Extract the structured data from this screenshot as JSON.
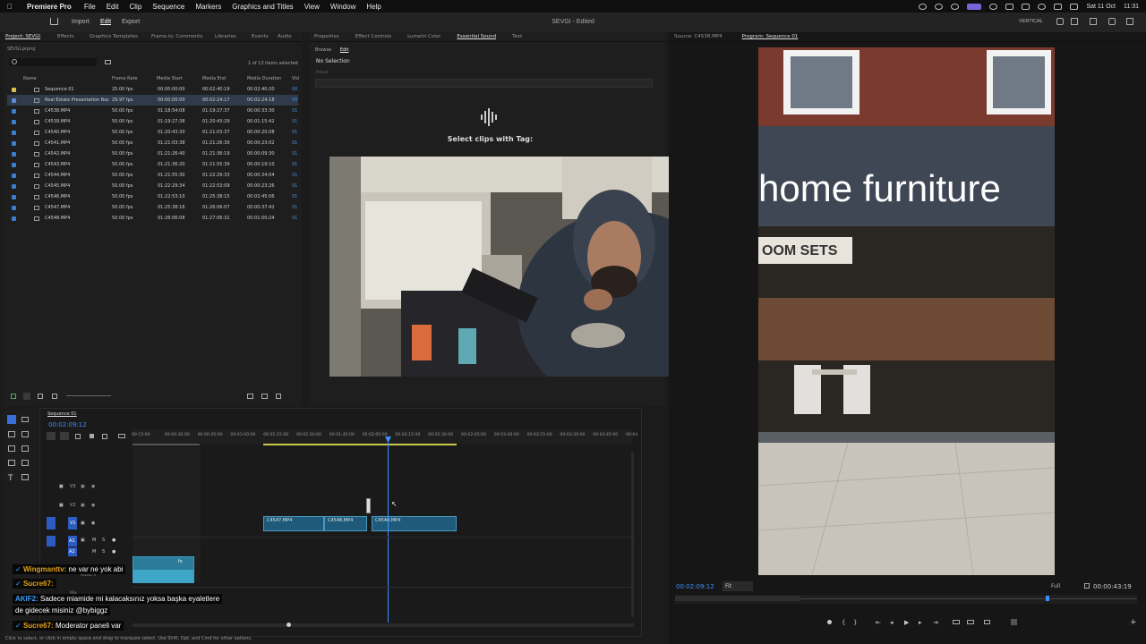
{
  "menubar": {
    "app_name": "Premiere Pro",
    "items": [
      "File",
      "Edit",
      "Clip",
      "Sequence",
      "Markers",
      "Graphics and Titles",
      "View",
      "Window",
      "Help"
    ],
    "date": "Sat 11 Oct",
    "time": "11:31"
  },
  "topbar": {
    "nav": [
      "Import",
      "Edit",
      "Export"
    ],
    "active_nav": "Edit",
    "doc_title": "SEVGI - Edited",
    "vertical_label": "VERTICAL"
  },
  "project": {
    "tabs": [
      "Project: SEVGI",
      "Effects",
      "Graphics Templates",
      "Frame.io: Comments",
      "Libraries",
      "Events",
      "Audio"
    ],
    "path": "SEVGI.prproj",
    "count": "1 of 13 items selected",
    "columns": [
      "Name",
      "Frame Rate",
      "Media Start",
      "Media End",
      "Media Duration",
      "Vid"
    ],
    "rows": [
      {
        "name": "Sequence 01",
        "rate": "25.00 fps",
        "start": "00:00:00:00",
        "end": "00:02:40:19",
        "dur": "00:02:40:20",
        "vid": "00",
        "color": "#d8c34a"
      },
      {
        "name": "Real Estate Presentation Bac",
        "rate": "29.97 fps",
        "start": "00:00:00:00",
        "end": "00:02:24:17",
        "dur": "00:02:24:18",
        "vid": "00",
        "color": "#5a8fd8"
      },
      {
        "name": "C4538.MP4",
        "rate": "50.00 fps",
        "start": "01:18:54:08",
        "end": "01:19:27:37",
        "dur": "00:00:33:30",
        "vid": "01",
        "color": "#3a7fcf"
      },
      {
        "name": "C4539.MP4",
        "rate": "50.00 fps",
        "start": "01:19:27:38",
        "end": "01:20:43:29",
        "dur": "00:01:15:42",
        "vid": "01",
        "color": "#3a7fcf"
      },
      {
        "name": "C4540.MP4",
        "rate": "50.00 fps",
        "start": "01:20:43:30",
        "end": "01:21:03:37",
        "dur": "00:00:20:08",
        "vid": "01",
        "color": "#3a7fcf"
      },
      {
        "name": "C4541.MP4",
        "rate": "50.00 fps",
        "start": "01:21:03:38",
        "end": "01:21:26:39",
        "dur": "00:00:23:02",
        "vid": "01",
        "color": "#3a7fcf"
      },
      {
        "name": "C4542.MP4",
        "rate": "50.00 fps",
        "start": "01:21:26:40",
        "end": "01:21:36:19",
        "dur": "00:00:09:30",
        "vid": "01",
        "color": "#3a7fcf"
      },
      {
        "name": "C4543.MP4",
        "rate": "50.00 fps",
        "start": "01:21:36:20",
        "end": "01:21:55:39",
        "dur": "00:00:19:10",
        "vid": "01",
        "color": "#3a7fcf"
      },
      {
        "name": "C4544.MP4",
        "rate": "50.00 fps",
        "start": "01:21:55:30",
        "end": "01:22:29:33",
        "dur": "00:00:34:04",
        "vid": "01",
        "color": "#3a7fcf"
      },
      {
        "name": "C4545.MP4",
        "rate": "50.00 fps",
        "start": "01:22:29:34",
        "end": "01:22:53:09",
        "dur": "00:00:23:26",
        "vid": "01",
        "color": "#3a7fcf"
      },
      {
        "name": "C4546.MP4",
        "rate": "50.00 fps",
        "start": "01:22:53:10",
        "end": "01:25:38:15",
        "dur": "00:02:45:06",
        "vid": "01",
        "color": "#3a7fcf"
      },
      {
        "name": "C4547.MP4",
        "rate": "50.00 fps",
        "start": "01:25:38:16",
        "end": "01:26:06:07",
        "dur": "00:00:37:42",
        "vid": "01",
        "color": "#3a7fcf"
      },
      {
        "name": "C4548.MP4",
        "rate": "50.00 fps",
        "start": "01:26:06:08",
        "end": "01:27:06:31",
        "dur": "00:01:00:24",
        "vid": "01",
        "color": "#3a7fcf"
      }
    ]
  },
  "esound": {
    "tabs": [
      "Properties",
      "Effect Controls",
      "Lumetri Color",
      "Essential Sound",
      "Text"
    ],
    "sub": [
      "Browse",
      "Edit"
    ],
    "no_selection": "No Selection",
    "preset": "Preset",
    "select_text": "Select clips with Tag:"
  },
  "program": {
    "tabs": [
      "Source: C4538.MP4",
      "Program: Sequence 01"
    ],
    "sign_text": "home furniture",
    "sign2_text": "OOM SETS",
    "timecode": "00:02:09:12",
    "fit": "Fit",
    "quality": "Full",
    "duration": "00:00:43:19"
  },
  "timeline": {
    "seq_tab": "Sequence 01",
    "timecode": "00:02:09:12",
    "ruler": [
      "00:15:00",
      "00:00:30:00",
      "00:00:45:00",
      "00:01:00:00",
      "00:01:15:00",
      "00:01:30:00",
      "00:01:45:00",
      "00:02:00:00",
      "00:02:15:00",
      "00:02:30:00",
      "00:02:45:00",
      "00:03:00:00",
      "00:03:15:00",
      "00:03:30:00",
      "00:03:45:00",
      "00:04"
    ],
    "tracks": [
      "V3",
      "V2",
      "V1",
      "A1",
      "A2"
    ],
    "clips": [
      "C4547.MP4",
      "C4548.MP4",
      "C4548.MP4"
    ],
    "audio_label": "Audio 3",
    "mix_label": "Mix"
  },
  "chat": [
    {
      "nick": "Wingmanttv:",
      "msg": " ne var ne yok abi",
      "color": "#e3a21a"
    },
    {
      "nick": "Sucre67:",
      "msg": "",
      "color": "#e3a21a"
    },
    {
      "nick": "AKIF2:",
      "msg": " Sadece miamide mi kalacaksınız yoksa başka eyaletlere",
      "color": "#3b9cff"
    },
    {
      "nick": "",
      "msg": "de gidecek misiniz @bybiggz",
      "color": "#fff"
    },
    {
      "nick": "Sucre67:",
      "msg": " Moderator paneli var",
      "color": "#e3a21a"
    }
  ],
  "status": "Click to select, or click in empty space and drag to marquee select. Use Shift, Opt, and Cmd for other options."
}
